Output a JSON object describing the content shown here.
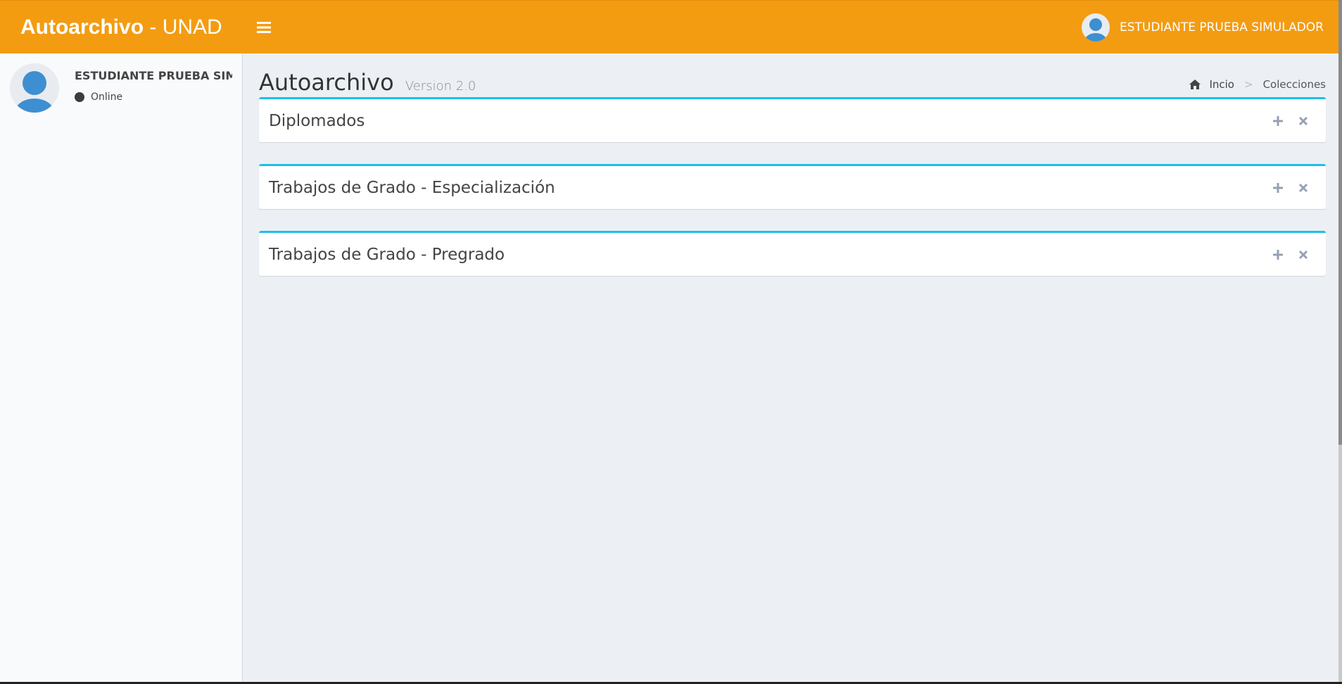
{
  "header": {
    "brand_bold": "Autoarchivo",
    "brand_rest": " - UNAD",
    "user_name": "ESTUDIANTE PRUEBA SIMULADOR",
    "accent_color": "#f39c12"
  },
  "sidebar": {
    "user_name": "ESTUDIANTE PRUEBA SIMULADOR",
    "status": "Online"
  },
  "content": {
    "title": "Autoarchivo",
    "subtitle": "Version 2.0",
    "breadcrumb": {
      "home": "Incio",
      "separator": ">",
      "current": "Colecciones"
    },
    "boxes": [
      {
        "title": "Diplomados"
      },
      {
        "title": "Trabajos de Grado - Especialización"
      },
      {
        "title": "Trabajos de Grado - Pregrado"
      }
    ],
    "box_border_color": "#1cc0e8"
  },
  "icons": {
    "menu": "hamburger-icon",
    "avatar": "user-avatar-icon",
    "home": "home-icon",
    "expand": "plus-icon",
    "remove": "close-icon"
  }
}
